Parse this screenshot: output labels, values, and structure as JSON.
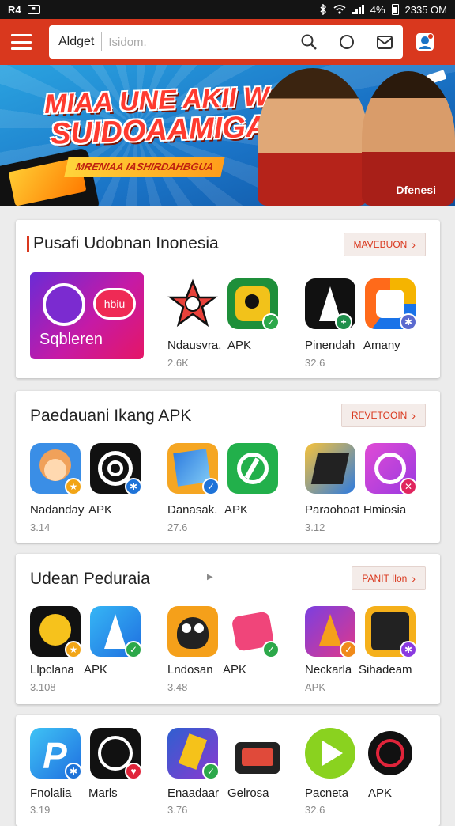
{
  "status_bar": {
    "left_text": "R4",
    "battery_percent": "4%",
    "time": "2335 OM"
  },
  "app_bar": {
    "brand": "Aldget",
    "search_placeholder": "Isidom."
  },
  "banner": {
    "title_line1": "MIAA UNE AKII W",
    "title_line2": "SUIDOAAMIGA",
    "subtitle": "MRENIAA IASHIRDAHBGUA",
    "brand": "Dfenesi"
  },
  "sections": [
    {
      "title": "Pusafi Udobnan Inonesia",
      "more_label": "MAVEBUON",
      "featured": {
        "label": "Sqbleren",
        "pill": "hbiu"
      },
      "apps": [
        {
          "name": "Ndausvra.",
          "sub": "2.6K"
        },
        {
          "name": "APK",
          "sub": ""
        },
        {
          "name": "Pinendah",
          "sub": "32.6"
        },
        {
          "name": "Amany",
          "sub": ""
        }
      ]
    },
    {
      "title": "Paedauani Ikang APK",
      "more_label": "REVETOOIN",
      "apps": [
        {
          "name": "Nadanday",
          "sub": "3.14"
        },
        {
          "name": "APK",
          "sub": ""
        },
        {
          "name": "Danasak.",
          "sub": "27.6"
        },
        {
          "name": "APK",
          "sub": ""
        },
        {
          "name": "Paraohoat",
          "sub": "3.12"
        },
        {
          "name": "Hmiosia",
          "sub": ""
        }
      ]
    },
    {
      "title": "Udean Peduraia",
      "more_label": "PANIT Ilon",
      "apps": [
        {
          "name": "Llpclana",
          "sub": "3.108"
        },
        {
          "name": "APK",
          "sub": ""
        },
        {
          "name": "Lndosan",
          "sub": "3.48"
        },
        {
          "name": "APK",
          "sub": ""
        },
        {
          "name": "Neckarla",
          "sub": "APK"
        },
        {
          "name": "Sihadeam",
          "sub": ""
        }
      ]
    },
    {
      "title": "",
      "more_label": "",
      "apps": [
        {
          "name": "Fnolalia",
          "sub": "3.19"
        },
        {
          "name": "Marls",
          "sub": ""
        },
        {
          "name": "Enaadaar",
          "sub": "3.76"
        },
        {
          "name": "Gelrosa",
          "sub": ""
        },
        {
          "name": "Pacneta",
          "sub": "32.6"
        },
        {
          "name": "APK",
          "sub": ""
        }
      ]
    }
  ],
  "colors": {
    "accent": "#d9381e",
    "background": "#ececec",
    "banner": "#1a73c6"
  },
  "icons": [
    "menu-icon",
    "search-icon",
    "circle-icon",
    "mail-icon",
    "profile-icon",
    "wifi-icon",
    "signal-icon",
    "battery-icon",
    "bluetooth-icon"
  ]
}
